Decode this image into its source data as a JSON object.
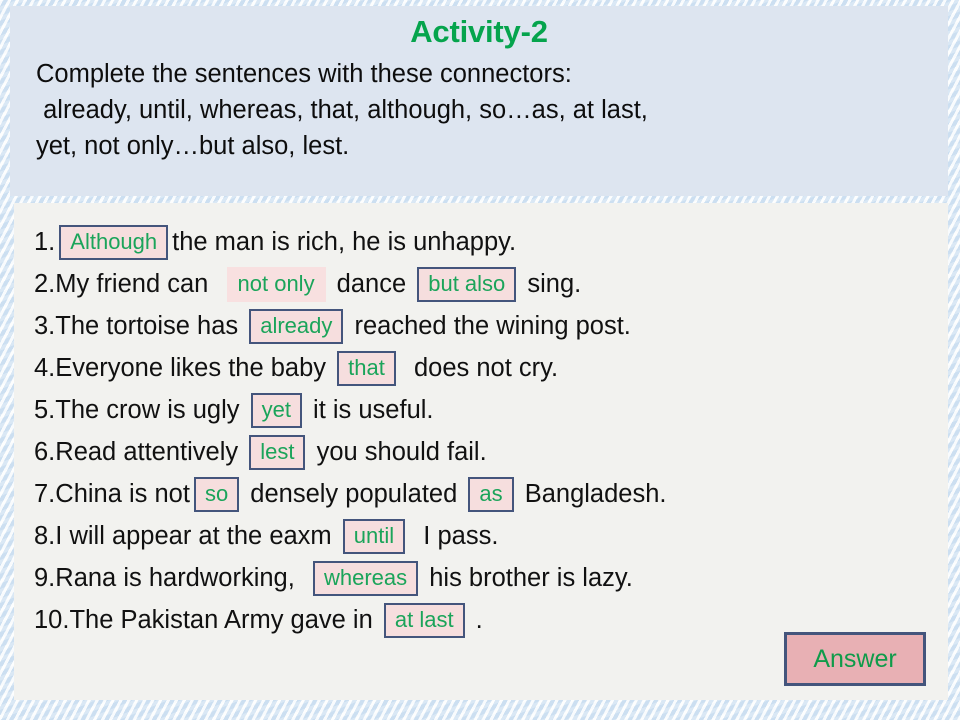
{
  "header": {
    "title": "Activity-2",
    "instructions": "Complete the sentences with these connectors:\n already, until, whereas, that, although, so…as, at last,\nyet, not only…but also, lest."
  },
  "answer_button": {
    "label": "Answer"
  },
  "colors": {
    "title_green": "#05a44d",
    "chip_text_green": "#1ba45a",
    "chip_background_pink": "#f6dede",
    "chip_border_navy": "#44557c",
    "answer_button_pink": "#e8b0b4",
    "header_panel": "#dde5f0",
    "content_panel": "#f2f2ef",
    "backdrop_blue": "#e3edf7"
  },
  "sentences": [
    {
      "number": "1.",
      "parts": [
        {
          "type": "chip",
          "text": "Although",
          "bordered": true
        },
        {
          "type": "text",
          "text": "the man is rich, he is unhappy."
        }
      ]
    },
    {
      "number": "2.",
      "parts": [
        {
          "type": "text",
          "text": "My friend can  "
        },
        {
          "type": "chip",
          "text": "not only",
          "bordered": false
        },
        {
          "type": "text",
          "text": " dance "
        },
        {
          "type": "chip",
          "text": "but also",
          "bordered": true
        },
        {
          "type": "text",
          "text": " sing."
        }
      ]
    },
    {
      "number": "3.",
      "parts": [
        {
          "type": "text",
          "text": "The tortoise has "
        },
        {
          "type": "chip",
          "text": "already",
          "bordered": true
        },
        {
          "type": "text",
          "text": " reached the wining post."
        }
      ]
    },
    {
      "number": "4.",
      "parts": [
        {
          "type": "text",
          "text": "Everyone likes the baby "
        },
        {
          "type": "chip",
          "text": "that",
          "bordered": true
        },
        {
          "type": "text",
          "text": "  does not cry."
        }
      ]
    },
    {
      "number": "5.",
      "parts": [
        {
          "type": "text",
          "text": "The crow is ugly "
        },
        {
          "type": "chip",
          "text": "yet",
          "bordered": true
        },
        {
          "type": "text",
          "text": " it is useful."
        }
      ]
    },
    {
      "number": "6.",
      "parts": [
        {
          "type": "text",
          "text": "Read attentively "
        },
        {
          "type": "chip",
          "text": "lest",
          "bordered": true
        },
        {
          "type": "text",
          "text": " you should fail."
        }
      ]
    },
    {
      "number": "7.",
      "parts": [
        {
          "type": "text",
          "text": "China is not"
        },
        {
          "type": "chip",
          "text": "so",
          "bordered": true
        },
        {
          "type": "text",
          "text": " densely populated "
        },
        {
          "type": "chip",
          "text": "as",
          "bordered": true
        },
        {
          "type": "text",
          "text": " Bangladesh."
        }
      ]
    },
    {
      "number": "8.",
      "parts": [
        {
          "type": "text",
          "text": "I will appear at the eaxm "
        },
        {
          "type": "chip",
          "text": "until",
          "bordered": true
        },
        {
          "type": "text",
          "text": "  I pass."
        }
      ]
    },
    {
      "number": "9.",
      "parts": [
        {
          "type": "text",
          "text": "Rana is hardworking,  "
        },
        {
          "type": "chip",
          "text": "whereas",
          "bordered": true
        },
        {
          "type": "text",
          "text": " his brother is lazy."
        }
      ]
    },
    {
      "number": "10.",
      "parts": [
        {
          "type": "text",
          "text": "The Pakistan Army gave in "
        },
        {
          "type": "chip",
          "text": "at last",
          "bordered": true
        },
        {
          "type": "text",
          "text": " ."
        }
      ]
    }
  ]
}
